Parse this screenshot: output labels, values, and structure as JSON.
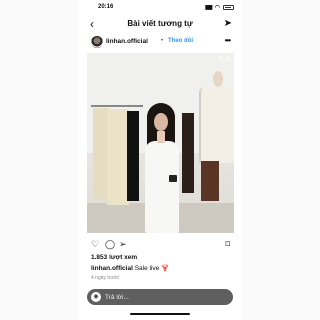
{
  "status": {
    "time": "20:16"
  },
  "nav": {
    "title": "Bài viết tương tự"
  },
  "post": {
    "username": "linhan.official",
    "dot": "•",
    "follow_label": "Theo dõi",
    "views": "1.853 lượt xem",
    "caption_user": "linhan.official",
    "caption_text": "Sale live 🦞",
    "time_ago": "4 ngày trước",
    "watermark": "FL 6"
  },
  "reply": {
    "placeholder": "Trả lời..."
  },
  "icons": {
    "back": "chevron-left-icon",
    "send": "send-icon",
    "more": "more-horizontal-icon",
    "heart": "heart-icon",
    "comment": "comment-icon",
    "share": "share-icon",
    "bookmark": "bookmark-icon",
    "camera": "camera-icon"
  },
  "colors": {
    "follow": "#3897f0",
    "reply_bar": "#5f5f5f"
  }
}
